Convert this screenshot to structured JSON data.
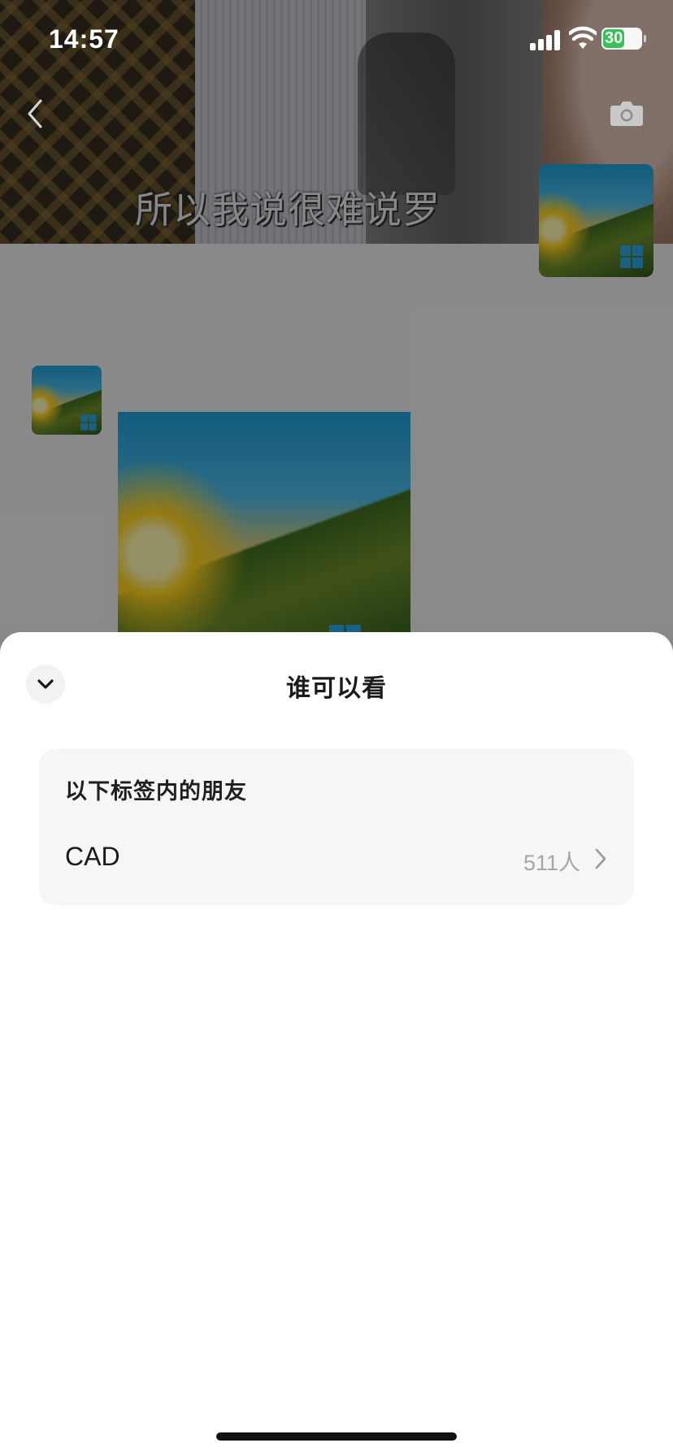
{
  "status_bar": {
    "time": "14:57",
    "battery": "30"
  },
  "background": {
    "cover_subtitle": "所以我说很难说罗"
  },
  "sheet": {
    "title": "谁可以看",
    "section": {
      "heading": "以下标签内的朋友",
      "tags": [
        {
          "name": "CAD",
          "count": "511人"
        }
      ]
    }
  },
  "icons": {
    "collapse": "chevron-down-icon",
    "row_chevron": "chevron-right-icon",
    "back": "back-arrow-icon",
    "camera": "camera-icon"
  },
  "colors": {
    "battery_fill": "#34c759",
    "card_bg": "#f6f6f6",
    "overlay": "rgba(0,0,0,0.42)"
  }
}
